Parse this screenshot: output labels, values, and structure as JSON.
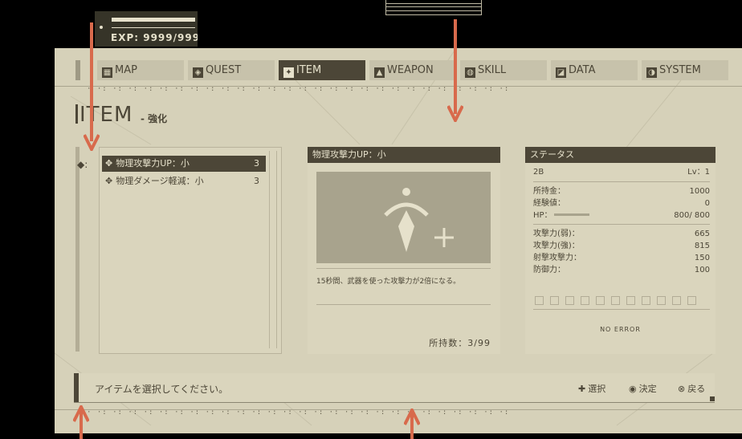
{
  "hud": {
    "exp": "EXP: 9999/999"
  },
  "tabs": [
    {
      "label": "MAP",
      "icon": "map-icon",
      "glyph": "▦",
      "active": false
    },
    {
      "label": "QUEST",
      "icon": "quest-icon",
      "glyph": "◈",
      "active": false
    },
    {
      "label": "ITEM",
      "icon": "item-icon",
      "glyph": "✦",
      "active": true
    },
    {
      "label": "WEAPON",
      "icon": "weapon-icon",
      "glyph": "▲",
      "active": false
    },
    {
      "label": "SKILL",
      "icon": "skill-icon",
      "glyph": "◍",
      "active": false
    },
    {
      "label": "DATA",
      "icon": "data-icon",
      "glyph": "◪",
      "active": false
    },
    {
      "label": "SYSTEM",
      "icon": "system-icon",
      "glyph": "◑",
      "active": false
    }
  ],
  "page": {
    "title": "ITEM",
    "subtitle": "- 強化"
  },
  "items": [
    {
      "name": "物理攻撃力UP：小",
      "count": "3",
      "selected": true
    },
    {
      "name": "物理ダメージ軽減：小",
      "count": "3",
      "selected": false
    }
  ],
  "description": {
    "header": "物理攻撃力UP：小",
    "text": "15秒間、武器を使った攻撃力が2倍になる。",
    "owned": "所持数：3/99"
  },
  "status": {
    "header": "ステータス",
    "name": "2B",
    "level": "Lv：1",
    "rows_money": [
      {
        "label": "所持金：",
        "value": "1000"
      },
      {
        "label": "経験値：",
        "value": "0"
      },
      {
        "label": "HP：",
        "value": "800/ 800"
      }
    ],
    "rows_combat": [
      {
        "label": "攻撃力(弱)：",
        "value": "665"
      },
      {
        "label": "攻撃力(強)：",
        "value": "815"
      },
      {
        "label": "射撃攻撃力：",
        "value": "150"
      },
      {
        "label": "防御力：",
        "value": "100"
      }
    ],
    "hp_fraction": 1.0,
    "error_text": "NO ERROR"
  },
  "message": "アイテムを選択してください。",
  "controls": [
    {
      "glyph": "✚",
      "icon": "dpad-icon",
      "label": "選択"
    },
    {
      "glyph": "◉",
      "icon": "circle-button-icon",
      "label": "決定"
    },
    {
      "glyph": "⊗",
      "icon": "cross-button-icon",
      "label": "戻る"
    }
  ],
  "colors": {
    "panel": "#d6d1b9",
    "ink": "#4c4637",
    "arrow": "#d86a4c"
  }
}
